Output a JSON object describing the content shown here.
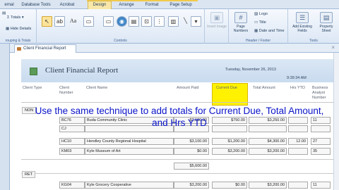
{
  "ribbon": {
    "contextual_label": "Report Design Tools",
    "tabs": [
      "ernal Data",
      "Database Tools",
      "Acrobat",
      "Design",
      "Arrange",
      "Format",
      "Page Setup"
    ],
    "grouping": {
      "totals_label": "Totals",
      "hide_details_label": "Hide Details",
      "group_label": "rouping & Totals"
    },
    "controls_group_label": "Controls",
    "insert_image_label": "Insert Image",
    "header_footer": {
      "page_numbers_label": "Page Numbers",
      "logo_label": "Logo",
      "title_label": "Title",
      "date_time_label": "Date and Time",
      "group_label": "Header / Footer"
    },
    "tools": {
      "add_fields_label": "Add Existing Fields",
      "property_sheet_label": "Property Sheet",
      "group_label": "Tools"
    }
  },
  "document_tab": {
    "label": "Client Financial Report"
  },
  "report": {
    "title": "Client Financial Report",
    "date": "Tuesday, November 26, 2013",
    "time": "9:39:34 AM",
    "columns": {
      "client_type": "Client Type",
      "client_number": "Client Number",
      "client_name": "Client Name",
      "amount_paid": "Amount Paid",
      "current_due": "Current Due",
      "total_amount": "Total Amount",
      "hrs_ytd": "Hrs YTD",
      "business_analyst": "Business Analyst Number"
    },
    "groups": [
      {
        "type": "NON",
        "rows": [
          {
            "number": "BC76",
            "name": "Buda Community Clinic",
            "paid": "$2,500.00",
            "due": "$750.00",
            "total": "$3,250.00",
            "hrs": "",
            "analyst": "11"
          },
          {
            "number": "CJ",
            "name": "",
            "paid": "",
            "due": "",
            "total": "",
            "hrs": "",
            "analyst": ""
          },
          {
            "number": "HC10",
            "name": "Hendley County Regional Hospital",
            "paid": "$3,100.00",
            "due": "$1,200.00",
            "total": "$4,300.00",
            "hrs": "12.00",
            "analyst": "27"
          },
          {
            "number": "KM03",
            "name": "Kyle Museum of Art",
            "paid": "$0.00",
            "due": "$3,200.00",
            "total": "$3,200.00",
            "hrs": "",
            "analyst": "35"
          }
        ],
        "subtotal": "$5,600.00"
      },
      {
        "type": "RET",
        "rows": [
          {
            "number": "KG04",
            "name": "Kyle Grocery Cooperative",
            "paid": "$3,200.00",
            "due": "$0.00",
            "total": "$3,200.00",
            "hrs": "",
            "analyst": "11"
          }
        ]
      }
    ]
  },
  "caption_text": "Use the same technique to add totals for Current Due, Total Amount, and Hrs YTD",
  "colors": {
    "caption": "#0a14c8",
    "highlight": "#fff200",
    "header_band": "#d3e1f2",
    "logo": "#5c9a58"
  }
}
